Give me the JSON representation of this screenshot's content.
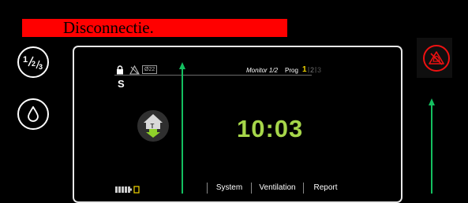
{
  "alarm": {
    "message": "Disconnectie."
  },
  "status": {
    "o2": "Ø22",
    "monitor": "Monitor 1/2",
    "prog_label": "Prog",
    "prog_active": "1",
    "prog_sep": "|",
    "prog_2": "2",
    "prog_3": "3"
  },
  "mode": "S",
  "clock": "10:03",
  "tabs": [
    {
      "label": "System"
    },
    {
      "label": "Ventilation"
    },
    {
      "label": "Report"
    }
  ],
  "colors": {
    "alarm": "#ff0000",
    "clock": "#a6d64a",
    "prog_active": "#f2d600",
    "annotation_arrow": "#14c060",
    "battery": "#cccccc",
    "battery_outline": "#f2d600"
  },
  "icons": {
    "fraction_button": "fraction-icon",
    "drop_button": "drop-icon",
    "alarm_silence": "alarm-silence-icon",
    "lock": "lock-icon",
    "alarm_off": "alarm-off-icon",
    "trigger": "inspiration-trigger-icon",
    "battery": "battery-icon"
  }
}
